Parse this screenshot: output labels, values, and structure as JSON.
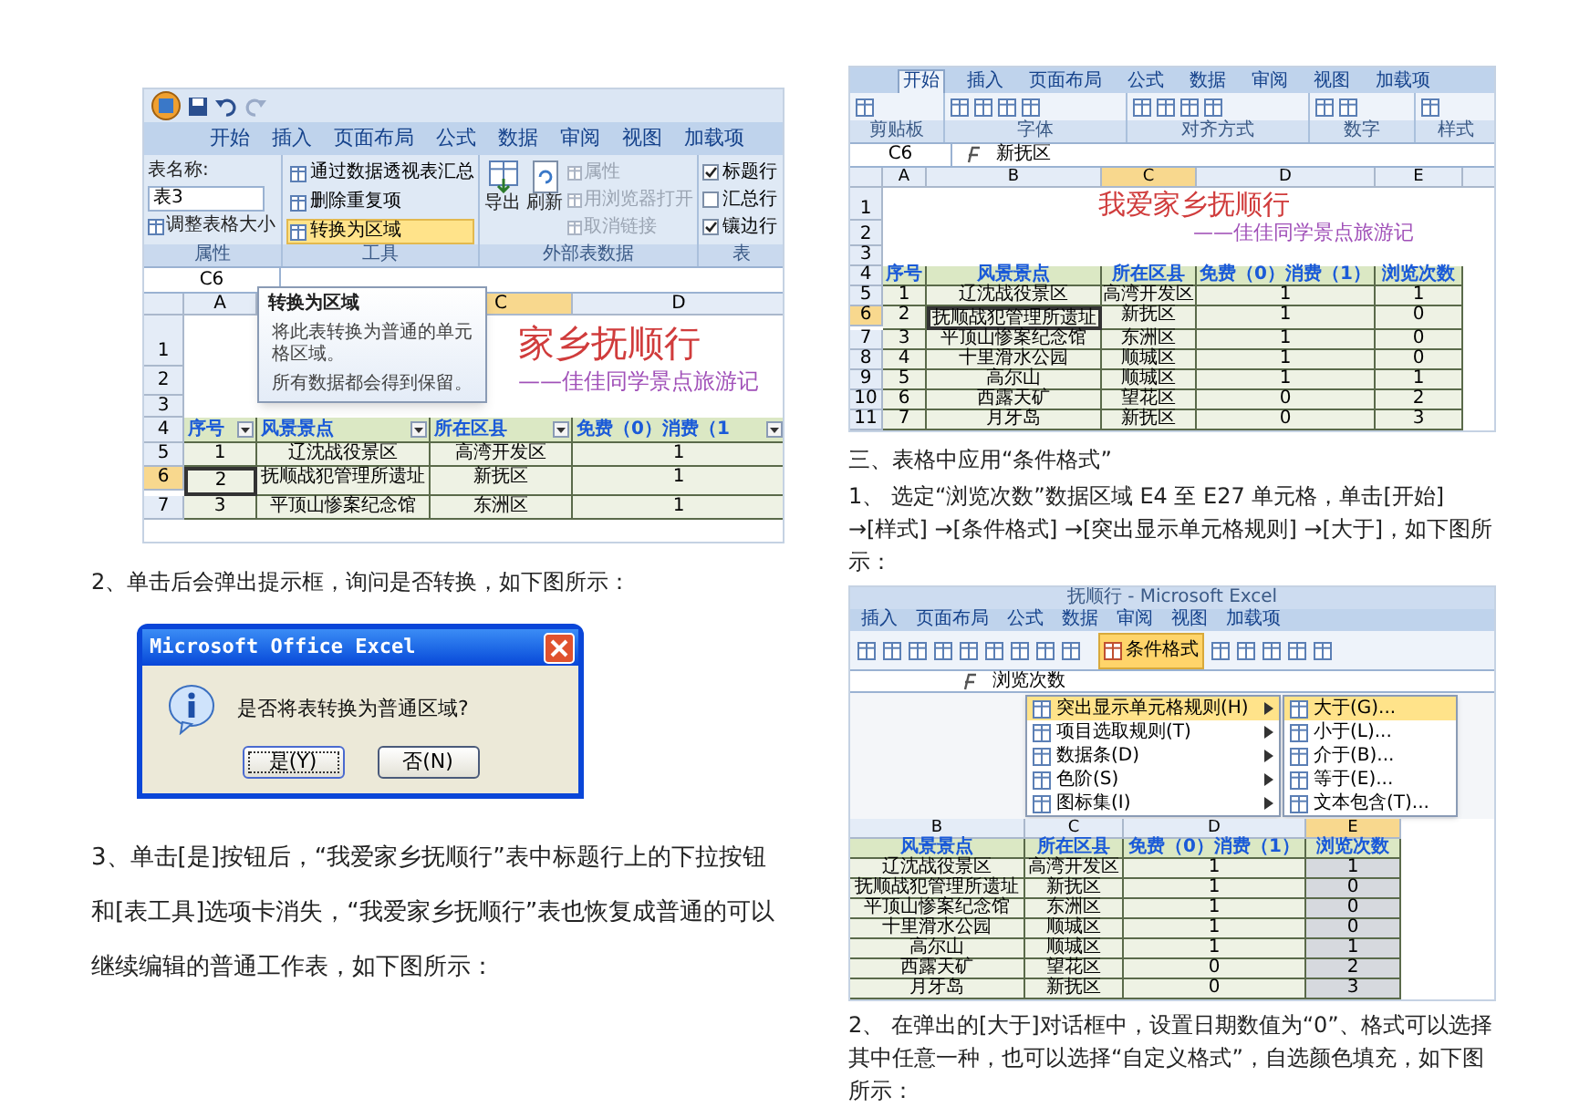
{
  "left_column": {
    "excel_screenshot": {
      "tabs": [
        "开始",
        "插入",
        "页面布局",
        "公式",
        "数据",
        "审阅",
        "视图",
        "加载项"
      ],
      "table_name_label": "表名称:",
      "table_name_value": "表3",
      "resize_table": "调整表格大小",
      "tool_items": [
        {
          "label": "通过数据透视表汇总",
          "highlighted": false
        },
        {
          "label": "删除重复项",
          "highlighted": false
        },
        {
          "label": "转换为区域",
          "highlighted": true
        }
      ],
      "export": "导出",
      "refresh": "刷新",
      "external_items": [
        {
          "label": "属性",
          "disabled": true
        },
        {
          "label": "用浏览器打开",
          "disabled": true
        },
        {
          "label": "取消链接",
          "disabled": true
        }
      ],
      "style_options": [
        {
          "label": "标题行",
          "checked": true
        },
        {
          "label": "汇总行",
          "checked": false
        },
        {
          "label": "镶边行",
          "checked": true
        }
      ],
      "group_labels": [
        "属性",
        "工具",
        "外部表数据",
        "表"
      ],
      "name_box": "C6",
      "column_headers": [
        {
          "label": "A",
          "selected": false
        },
        {
          "label": "C",
          "selected": true
        },
        {
          "label": "D",
          "selected": false
        }
      ],
      "row_numbers": [
        "1",
        "2",
        "3",
        "4"
      ],
      "title": "家乡抚顺行",
      "subtitle": "——佳佳同学景点旅游记",
      "header": [
        "序号",
        "风景景点",
        "所在区县",
        "免费（0）消费（1"
      ],
      "rows": [
        {
          "number": "5",
          "selected": false,
          "cells": [
            "1",
            "辽沈战役景区",
            "高湾开发区",
            "1"
          ]
        },
        {
          "number": "6",
          "selected": true,
          "cells": [
            "2",
            "抚顺战犯管理所遗址",
            "新抚区",
            "1"
          ]
        },
        {
          "number": "7",
          "selected": false,
          "cells": [
            "3",
            "平顶山惨案纪念馆",
            "东洲区",
            "1"
          ]
        }
      ],
      "tooltip": {
        "title": "转换为区域",
        "body": "将此表转换为普通的单元格区域。",
        "note": "所有数据都会得到保留。"
      }
    },
    "paragraph_2": "2、单击后会弹出提示框，询问是否转换，如下图所示：",
    "dialog": {
      "title": "Microsoft Office Excel",
      "message": "是否将表转换为普通区域?",
      "buttons": [
        {
          "label": "是(Y)",
          "focused": true
        },
        {
          "label": "否(N)",
          "focused": false
        }
      ]
    },
    "paragraph_3": "3、单击[是]按钮后，“我爱家乡抚顺行”表中标题行上的下拉按钮和[表工具]选项卡消失，“我爱家乡抚顺行”表也恢复成普通的可以继续编辑的普通工作表，如下图所示："
  },
  "right_column": {
    "excel_screenshot": {
      "tabs": [
        {
          "label": "开始",
          "selected": true
        },
        {
          "label": "插入",
          "selected": false
        },
        {
          "label": "页面布局",
          "selected": false
        },
        {
          "label": "公式",
          "selected": false
        },
        {
          "label": "数据",
          "selected": false
        },
        {
          "label": "审阅",
          "selected": false
        },
        {
          "label": "视图",
          "selected": false
        },
        {
          "label": "加载项",
          "selected": false
        }
      ],
      "group_labels": [
        "剪贴板",
        "字体",
        "对齐方式",
        "数字",
        "样式"
      ],
      "name_box": "C6",
      "formula": "新抚区",
      "column_headers": [
        {
          "label": "A",
          "selected": false
        },
        {
          "label": "B",
          "selected": false
        },
        {
          "label": "C",
          "selected": true
        },
        {
          "label": "D",
          "selected": false
        },
        {
          "label": "E",
          "selected": false
        }
      ],
      "row_numbers": [
        "1",
        "2",
        "3",
        "4"
      ],
      "title": "我爱家乡抚顺行",
      "subtitle": "——佳佳同学景点旅游记",
      "header": [
        "序号",
        "风景景点",
        "所在区县",
        "免费（0）消费（1）",
        "浏览次数"
      ],
      "rows": [
        {
          "number": "5",
          "selected": false,
          "cells": [
            "1",
            "辽沈战役景区",
            "高湾开发区",
            "1",
            "1"
          ]
        },
        {
          "number": "6",
          "selected": true,
          "cells": [
            "2",
            "抚顺战犯管理所遗址",
            "新抚区",
            "1",
            "0"
          ]
        },
        {
          "number": "7",
          "selected": false,
          "cells": [
            "3",
            "平顶山惨案纪念馆",
            "东洲区",
            "1",
            "0"
          ]
        },
        {
          "number": "8",
          "selected": false,
          "cells": [
            "4",
            "十里滑水公园",
            "顺城区",
            "1",
            "0"
          ]
        },
        {
          "number": "9",
          "selected": false,
          "cells": [
            "5",
            "高尔山",
            "顺城区",
            "1",
            "1"
          ]
        },
        {
          "number": "10",
          "selected": false,
          "cells": [
            "6",
            "西露天矿",
            "望花区",
            "0",
            "2"
          ]
        },
        {
          "number": "11",
          "selected": false,
          "cells": [
            "7",
            "月牙岛",
            "新抚区",
            "0",
            "3"
          ]
        }
      ]
    },
    "heading": "三、表格中应用“条件格式”",
    "paragraph_1": "1、 选定“浏览次数”数据区域 E4 至 E27 单元格，单击[开始] →[样式] →[条件格式] →[突出显示单元格规则] →[大于]，如下图所示：",
    "menu_screenshot": {
      "window_title": "抚顺行 - Microsoft Excel",
      "tabs": [
        "插入",
        "页面布局",
        "公式",
        "数据",
        "审阅",
        "视图",
        "加载项"
      ],
      "conditional_format_button": "条件格式",
      "formula": "浏览次数",
      "menu_items": [
        {
          "label": "突出显示单元格规则(H)",
          "highlighted": true
        },
        {
          "label": "项目选取规则(T)",
          "highlighted": false
        },
        {
          "label": "数据条(D)",
          "highlighted": false
        },
        {
          "label": "色阶(S)",
          "highlighted": false
        },
        {
          "label": "图标集(I)",
          "highlighted": false
        }
      ],
      "submenu_items": [
        {
          "label": "大于(G)...",
          "highlighted": true
        },
        {
          "label": "小于(L)...",
          "highlighted": false
        },
        {
          "label": "介于(B)...",
          "highlighted": false
        },
        {
          "label": "等于(E)...",
          "highlighted": false
        },
        {
          "label": "文本包含(T)...",
          "highlighted": false
        }
      ],
      "column_headers": [
        {
          "label": "B",
          "selected": false
        },
        {
          "label": "C",
          "selected": false
        },
        {
          "label": "D",
          "selected": false
        },
        {
          "label": "E",
          "selected": true
        }
      ],
      "header": [
        "风景景点",
        "所在区县",
        "免费（0）消费（1）",
        "浏览次数"
      ],
      "rows": [
        [
          "辽沈战役景区",
          "高湾开发区",
          "1",
          "1"
        ],
        [
          "抚顺战犯管理所遗址",
          "新抚区",
          "1",
          "0"
        ],
        [
          "平顶山惨案纪念馆",
          "东洲区",
          "1",
          "0"
        ],
        [
          "十里滑水公园",
          "顺城区",
          "1",
          "0"
        ],
        [
          "高尔山",
          "顺城区",
          "1",
          "1"
        ],
        [
          "西露天矿",
          "望花区",
          "0",
          "2"
        ],
        [
          "月牙岛",
          "新抚区",
          "0",
          "3"
        ]
      ]
    },
    "paragraph_2": "2、 在弹出的[大于]对话框中，设置日期数值为“0”、格式可以选择其中任意一种，也可以选择“自定义格式”，自选颜色填充，如下图所示："
  }
}
